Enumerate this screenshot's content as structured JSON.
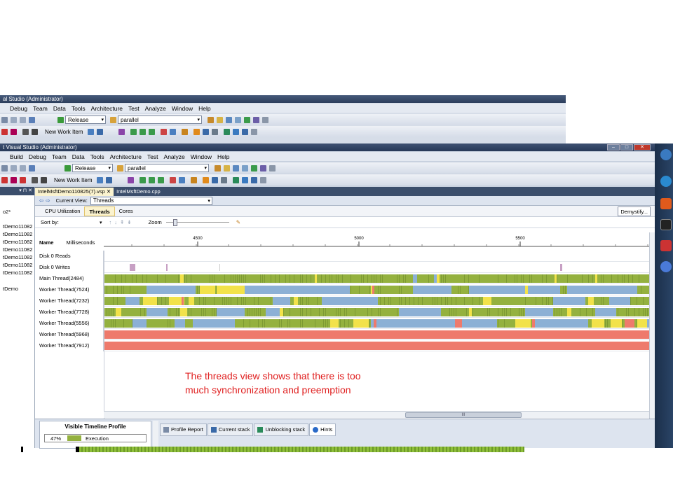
{
  "back_window": {
    "title": "al Studio (Administrator)",
    "menu": [
      "Debug",
      "Team",
      "Data",
      "Tools",
      "Architecture",
      "Test",
      "Analyze",
      "Window",
      "Help"
    ],
    "config": "Release",
    "project": "parallel",
    "new_work_item": "New Work Item"
  },
  "front_window": {
    "title": "t Visual Studio (Administrator)",
    "menu": [
      "Build",
      "Debug",
      "Team",
      "Data",
      "Tools",
      "Architecture",
      "Test",
      "Analyze",
      "Window",
      "Help"
    ],
    "config": "Release",
    "project": "parallel",
    "new_work_item": "New Work Item",
    "win_buttons": [
      "–",
      "□",
      "✕"
    ]
  },
  "solution_panel": {
    "header": "▾ ⊓ ✕",
    "items": [
      "o2*",
      "tDemo11082",
      "tDemo11082",
      "tDemo11082",
      "tDemo11082",
      "tDemo11082",
      "tDemo11082",
      "tDemo11082",
      "tDemo"
    ]
  },
  "doc_tabs": [
    "IntelMsftDemo110825(7).vsp",
    "IntelMsftDemo.cpp"
  ],
  "current_view_label": "Current View:",
  "current_view_value": "Threads",
  "mode_tabs": [
    "CPU Utilization",
    "Threads",
    "Cores"
  ],
  "demystify": "Demystify...",
  "sort_label": "Sort by:",
  "zoom_label": "Zoom",
  "name_header": "Name",
  "ms_header": "Milliseconds",
  "ruler_ticks": [
    "4500",
    "5000",
    "5500"
  ],
  "rows": [
    {
      "label": "Disk 0 Reads",
      "type": "disk"
    },
    {
      "label": "Disk 0 Writes",
      "type": "diskw"
    },
    {
      "label": "Main Thread(2484)",
      "type": "main"
    },
    {
      "label": "Worker Thread(7524)",
      "type": "w1"
    },
    {
      "label": "Worker Thread(7232)",
      "type": "w2"
    },
    {
      "label": "Worker Thread(7728)",
      "type": "w3"
    },
    {
      "label": "Worker Thread(5556)",
      "type": "w4"
    },
    {
      "label": "Worker Thread(5968)",
      "type": "sync"
    },
    {
      "label": "Worker Thread(7912)",
      "type": "sync"
    }
  ],
  "annotation_line1": "The threads view shows that there is too",
  "annotation_line2": "much synchronization and preemption",
  "scroll_mark": "III",
  "visible_timeline": {
    "title": "Visible Timeline Profile",
    "execution_pct": "47%",
    "execution_label": "Execution"
  },
  "bottom_tabs": [
    "Profile Report",
    "Current stack",
    "Unblocking stack",
    "Hints"
  ],
  "colors": {
    "execution": "#94b13f",
    "sync": "#ee7a6c",
    "preempt": "#f2e24a",
    "sleep": "#8cb0d5",
    "io": "#c7a0c4"
  }
}
